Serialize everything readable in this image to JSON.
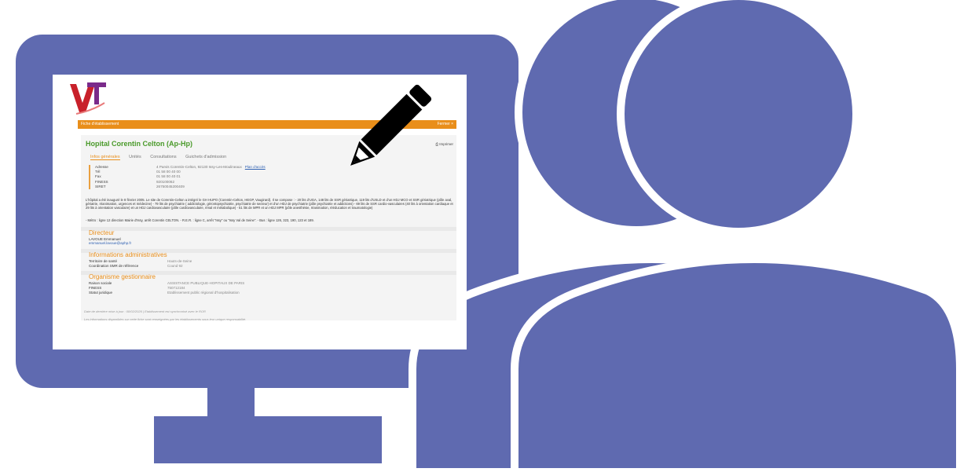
{
  "colors": {
    "accent": "#5f6ab0",
    "orange": "#e98e1a",
    "green": "#4a9a2a"
  },
  "icons": {
    "pen": "pencil-icon",
    "user": "user-icon",
    "monitor": "monitor-icon",
    "print": "printer-icon"
  },
  "screen": {
    "bar_title": "Fiche d'établissement",
    "bar_close": "Fermer ×",
    "hospital_title": "Hopital Corentin Celton (Ap-Hp)",
    "print_label": "Imprimer",
    "tabs": [
      "Infos générales",
      "Unités",
      "Consultations",
      "Guichets d'admission"
    ],
    "info_rows": [
      {
        "label": "Adresse",
        "value": "4 Parvis Corentin-Celton, 92130 Issy-Les-Moulineaux"
      },
      {
        "label": "Tél",
        "value": "01 58 00 40 00"
      },
      {
        "label": "Fax",
        "value": "01 58 00 40 01"
      },
      {
        "label": "FINESS",
        "value": "920100062"
      },
      {
        "label": "SIRET",
        "value": "26750045200409"
      }
    ],
    "access_link": "Plan d'accès",
    "description": "L'hôpital a été inauguré le 8 février 2005. Le site de Corentin-Celton a intégré le GH HUPO (Corentin-Celton, HEGP, Vaugirard). Il se compose : - 20 lits d'UGA, 148 lits de SSR gériatrique, 119 lits d'USLD et d'un HDJ MCO et SSR gériatrique (pôle aval, gériatrie, réanimation, urgences et médecine) - 79 lits de psychiatrie ( addictologie, gérontopsychiatrie, psychiatrie de secteur) et d'un HDJ de psychiatrie (pôle psychiatrie et addictions) - 69 lits de SSR cardio-vasculaires (40 lits à orientation cardiaque et 29 lits à orientation vasculaire) et un HDJ cardiovasculaire (pôle cardiovasculaire, rénal et métabolique) - 51 lits de MPR et un HDJ MPR (pôle anesthésie, réanimation, rééducation et traumatologie)",
    "transport": "- Métro : ligne 12 direction Mairie d'Issy, arrêt Corentin CELTON. - R.E.R. : ligne C, arrêt \"Issy\" ou \"Issy Val de Seine\". - Bus : ligne 126, 323, 190, 123 et 189.",
    "director_heading": "Directeur",
    "director_name": "LAVOUE Emmanuel",
    "director_email": "emmanuel.lavoue@aphp.fr",
    "admin_heading": "Informations administratives",
    "admin_rows": [
      {
        "label": "Territoire de santé",
        "value": "Hauts-de-Seine"
      },
      {
        "label": "Coordination SMR de référence",
        "value": "Cound 92"
      }
    ],
    "org_heading": "Organisme gestionnaire",
    "org_rows": [
      {
        "label": "Raison sociale",
        "value": "ASSISTANCE PUBLIQUE-HOPITAUX DE PARIS"
      },
      {
        "label": "FINESS",
        "value": "750712184"
      },
      {
        "label": "Statut juridique",
        "value": "Etablissement public régional d'hospitalisation"
      }
    ],
    "footer_1": "Date de dernière mise à jour : 08/02/2026 | Etablissement est synchronisé avec le ROR",
    "footer_2": "Les informations disponibles sur cette fiche sont renseignées par les établissements sous leur unique responsabilité."
  }
}
